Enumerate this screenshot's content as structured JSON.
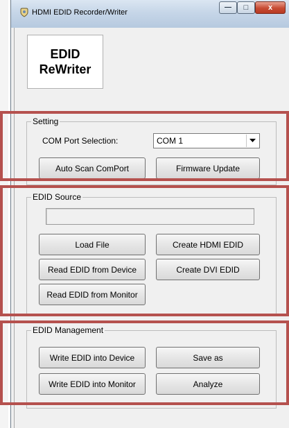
{
  "window": {
    "title": "HDMI EDID Recorder/Writer",
    "controls": {
      "minimize": "—",
      "maximize": "□",
      "close": "x"
    }
  },
  "logo": {
    "line1": "EDID",
    "line2": "ReWriter"
  },
  "setting": {
    "title": "Setting",
    "com_port_label": "COM Port Selection:",
    "com_port_value": "COM 1",
    "auto_scan_label": "Auto Scan ComPort",
    "firmware_update_label": "Firmware Update"
  },
  "edid_source": {
    "title": "EDID Source",
    "path_value": "",
    "load_file_label": "Load File",
    "create_hdmi_label": "Create HDMI EDID",
    "read_device_label": "Read EDID from Device",
    "create_dvi_label": "Create DVI EDID",
    "read_monitor_label": "Read EDID from Monitor"
  },
  "edid_management": {
    "title": "EDID Management",
    "write_device_label": "Write EDID into Device",
    "save_as_label": "Save as",
    "write_monitor_label": "Write EDID into Monitor",
    "analyze_label": "Analyze"
  },
  "colors": {
    "highlight": "#b5514e",
    "titlebar": "#c6d6e8",
    "close_button": "#c74b33"
  }
}
